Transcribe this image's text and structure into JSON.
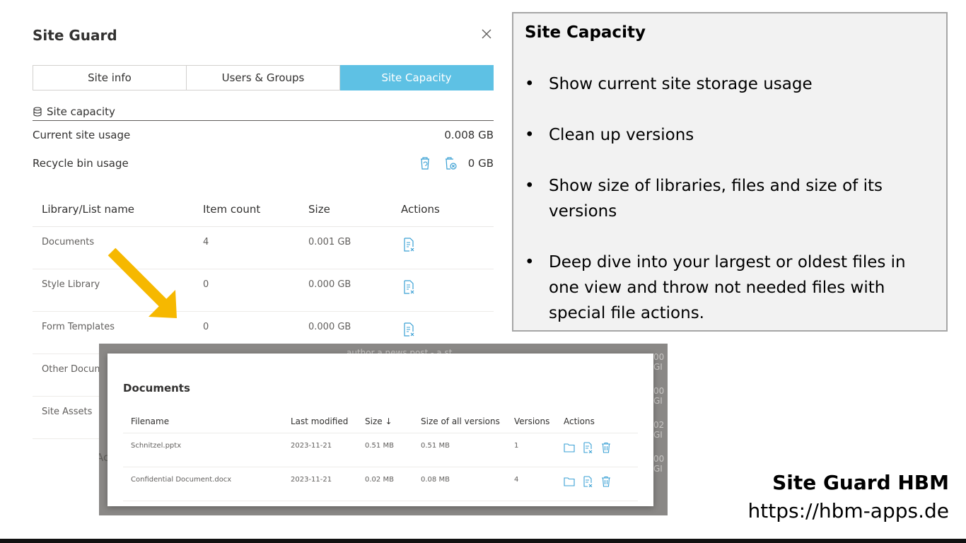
{
  "panel": {
    "title": "Site Guard",
    "tabs": [
      {
        "label": "Site info"
      },
      {
        "label": "Users & Groups"
      },
      {
        "label": "Site Capacity",
        "active": true
      }
    ],
    "section_label": "Site capacity",
    "current_usage": {
      "label": "Current site usage",
      "value": "0.008 GB"
    },
    "recycle_usage": {
      "label": "Recycle bin usage",
      "value": "0 GB"
    },
    "table": {
      "headers": [
        "Library/List name",
        "Item count",
        "Size",
        "Actions"
      ],
      "rows": [
        {
          "name": "Documents",
          "count": "4",
          "size": "0.001 GB"
        },
        {
          "name": "Style Library",
          "count": "0",
          "size": "0.000 GB"
        },
        {
          "name": "Form Templates",
          "count": "0",
          "size": "0.000 GB"
        },
        {
          "name": "Other Docume",
          "count": "",
          "size": ""
        },
        {
          "name": "Site Assets",
          "count": "",
          "size": ""
        }
      ]
    }
  },
  "documents": {
    "title": "Documents",
    "headers": [
      "Filename",
      "Last modified",
      "Size ↓",
      "Size of all versions",
      "Versions",
      "Actions"
    ],
    "rows": [
      {
        "filename": "Schnitzel.pptx",
        "modified": "2023-11-21",
        "size": "0.51 MB",
        "all_versions": "0.51 MB",
        "versions": "1"
      },
      {
        "filename": "Confidential Document.docx",
        "modified": "2023-11-21",
        "size": "0.02 MB",
        "all_versions": "0.08 MB",
        "versions": "4"
      }
    ],
    "background_fragments": [
      "author a news post - a st",
      "Ac",
      "00 GI",
      "00 GI",
      "02 GI",
      "00 GI"
    ]
  },
  "info": {
    "title": "Site Capacity",
    "bullets": [
      "Show current site storage usage",
      "Clean up versions",
      "Show size of libraries, files and size of its versions",
      "Deep dive into your largest or oldest files in one view and throw not needed files with special file actions."
    ]
  },
  "brand": {
    "name": "Site Guard HBM",
    "url": "https://hbm-apps.de"
  },
  "colors": {
    "accent": "#5ec1e4",
    "icon": "#3aa0d4",
    "arrow": "#f6b800"
  }
}
